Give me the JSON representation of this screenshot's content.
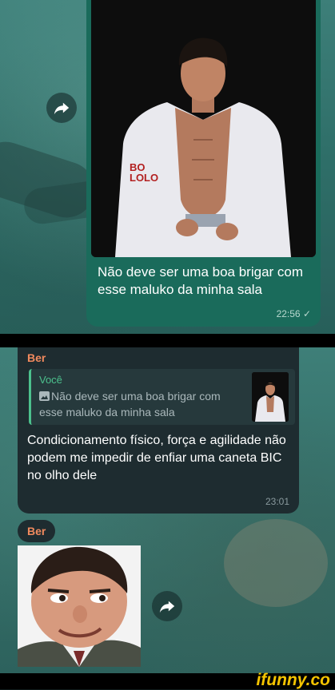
{
  "messages": {
    "outgoing": {
      "text": "Não deve ser uma boa brigar com esse maluko da minha sala",
      "time": "22:56 ✓",
      "image_caption": "BO LOLO"
    },
    "reply": {
      "sender": "Ber",
      "quoted_author": "Você",
      "quoted_text": "Não deve ser uma boa brigar com esse maluko da minha sala",
      "text": "Condicionamento físico, força e agilidade não podem me impedir de enfiar uma caneta BIC no olho dele",
      "time": "23:01"
    },
    "sticker_message": {
      "sender": "Ber"
    }
  },
  "watermark": "ifunny.co",
  "colors": {
    "outgoing_bubble": "#1a6b5b",
    "incoming_bubble": "#1e2c30",
    "sender_name": "#f18a5e",
    "quote_accent": "#4cc18d",
    "watermark": "#f5c400"
  },
  "icons": [
    "forward-icon",
    "image-icon"
  ]
}
